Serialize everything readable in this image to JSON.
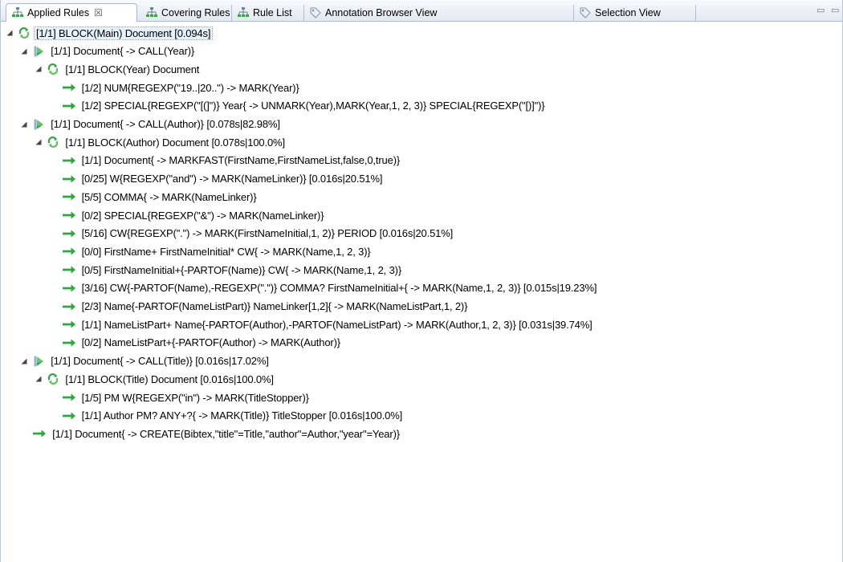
{
  "tabs": [
    {
      "label": "Applied Rules",
      "icon": "hierarchy-icon",
      "active": true,
      "close": "☒"
    },
    {
      "label": "Covering Rules",
      "icon": "hierarchy-icon",
      "active": false
    },
    {
      "label": "Rule List",
      "icon": "hierarchy-icon",
      "active": false
    },
    {
      "label": "Annotation Browser View",
      "icon": "tag-icon",
      "active": false
    },
    {
      "label": "Selection View",
      "icon": "tag-icon",
      "active": false
    }
  ],
  "view_controls": {
    "minimize": "▭",
    "maximize": "▭"
  },
  "colors": {
    "block": "#3aa34a",
    "call": "#2e8b57",
    "rule": "#2ca83c",
    "selection": "#e5f1fb"
  },
  "tree": [
    {
      "depth": 0,
      "type": "block",
      "expanded": true,
      "selected": true,
      "text": "[1/1] BLOCK(Main) Document  [0.094s]"
    },
    {
      "depth": 1,
      "type": "call",
      "expanded": true,
      "text": "[1/1] Document{ -> CALL(Year)}"
    },
    {
      "depth": 2,
      "type": "block",
      "expanded": true,
      "text": "[1/1] BLOCK(Year) Document"
    },
    {
      "depth": 3,
      "type": "rule",
      "text": "[1/2] NUM{REGEXP(\"19..|20..\") -> MARK(Year)}"
    },
    {
      "depth": 3,
      "type": "rule",
      "text": "[1/2] SPECIAL{REGEXP(\"[(]\")} Year{ -> UNMARK(Year),MARK(Year,1, 2, 3)} SPECIAL{REGEXP(\"[)]\")}"
    },
    {
      "depth": 1,
      "type": "call",
      "expanded": true,
      "text": "[1/1] Document{ -> CALL(Author)}  [0.078s|82.98%]"
    },
    {
      "depth": 2,
      "type": "block",
      "expanded": true,
      "text": "[1/1] BLOCK(Author) Document  [0.078s|100.0%]"
    },
    {
      "depth": 3,
      "type": "rule",
      "text": "[1/1] Document{ -> MARKFAST(FirstName,FirstNameList,false,0,true)}"
    },
    {
      "depth": 3,
      "type": "rule",
      "text": "[0/25] W{REGEXP(\"and\") -> MARK(NameLinker)}  [0.016s|20.51%]"
    },
    {
      "depth": 3,
      "type": "rule",
      "text": "[5/5] COMMA{ -> MARK(NameLinker)}"
    },
    {
      "depth": 3,
      "type": "rule",
      "text": "[0/2] SPECIAL{REGEXP(\"&\") -> MARK(NameLinker)}"
    },
    {
      "depth": 3,
      "type": "rule",
      "text": "[5/16] CW{REGEXP(\".\") -> MARK(FirstNameInitial,1, 2)} PERIOD  [0.016s|20.51%]"
    },
    {
      "depth": 3,
      "type": "rule",
      "text": "[0/0] FirstName+ FirstNameInitial* CW{ -> MARK(Name,1, 2, 3)}"
    },
    {
      "depth": 3,
      "type": "rule",
      "text": "[0/5] FirstNameInitial+{-PARTOF(Name)} CW{ -> MARK(Name,1, 2, 3)}"
    },
    {
      "depth": 3,
      "type": "rule",
      "text": "[3/16] CW{-PARTOF(Name),-REGEXP(\".\")} COMMA? FirstNameInitial+{ -> MARK(Name,1, 2, 3)}  [0.015s|19.23%]"
    },
    {
      "depth": 3,
      "type": "rule",
      "text": "[2/3] Name{-PARTOF(NameListPart)} NameLinker[1,2]{ -> MARK(NameListPart,1, 2)}"
    },
    {
      "depth": 3,
      "type": "rule",
      "text": "[1/1] NameListPart+ Name{-PARTOF(Author),-PARTOF(NameListPart) -> MARK(Author,1, 2, 3)}  [0.031s|39.74%]"
    },
    {
      "depth": 3,
      "type": "rule",
      "text": "[0/2] NameListPart+{-PARTOF(Author) -> MARK(Author)}"
    },
    {
      "depth": 1,
      "type": "call",
      "expanded": true,
      "text": "[1/1] Document{ -> CALL(Title)}  [0.016s|17.02%]"
    },
    {
      "depth": 2,
      "type": "block",
      "expanded": true,
      "text": "[1/1] BLOCK(Title) Document  [0.016s|100.0%]"
    },
    {
      "depth": 3,
      "type": "rule",
      "text": "[1/5] PM W{REGEXP(\"in\") -> MARK(TitleStopper)}"
    },
    {
      "depth": 3,
      "type": "rule",
      "text": "[1/1] Author PM? ANY+?{ -> MARK(Title)} TitleStopper  [0.016s|100.0%]"
    },
    {
      "depth": 1,
      "type": "rule",
      "text": "[1/1] Document{ -> CREATE(Bibtex,\"title\"=Title,\"author\"=Author,\"year\"=Year)}"
    }
  ]
}
